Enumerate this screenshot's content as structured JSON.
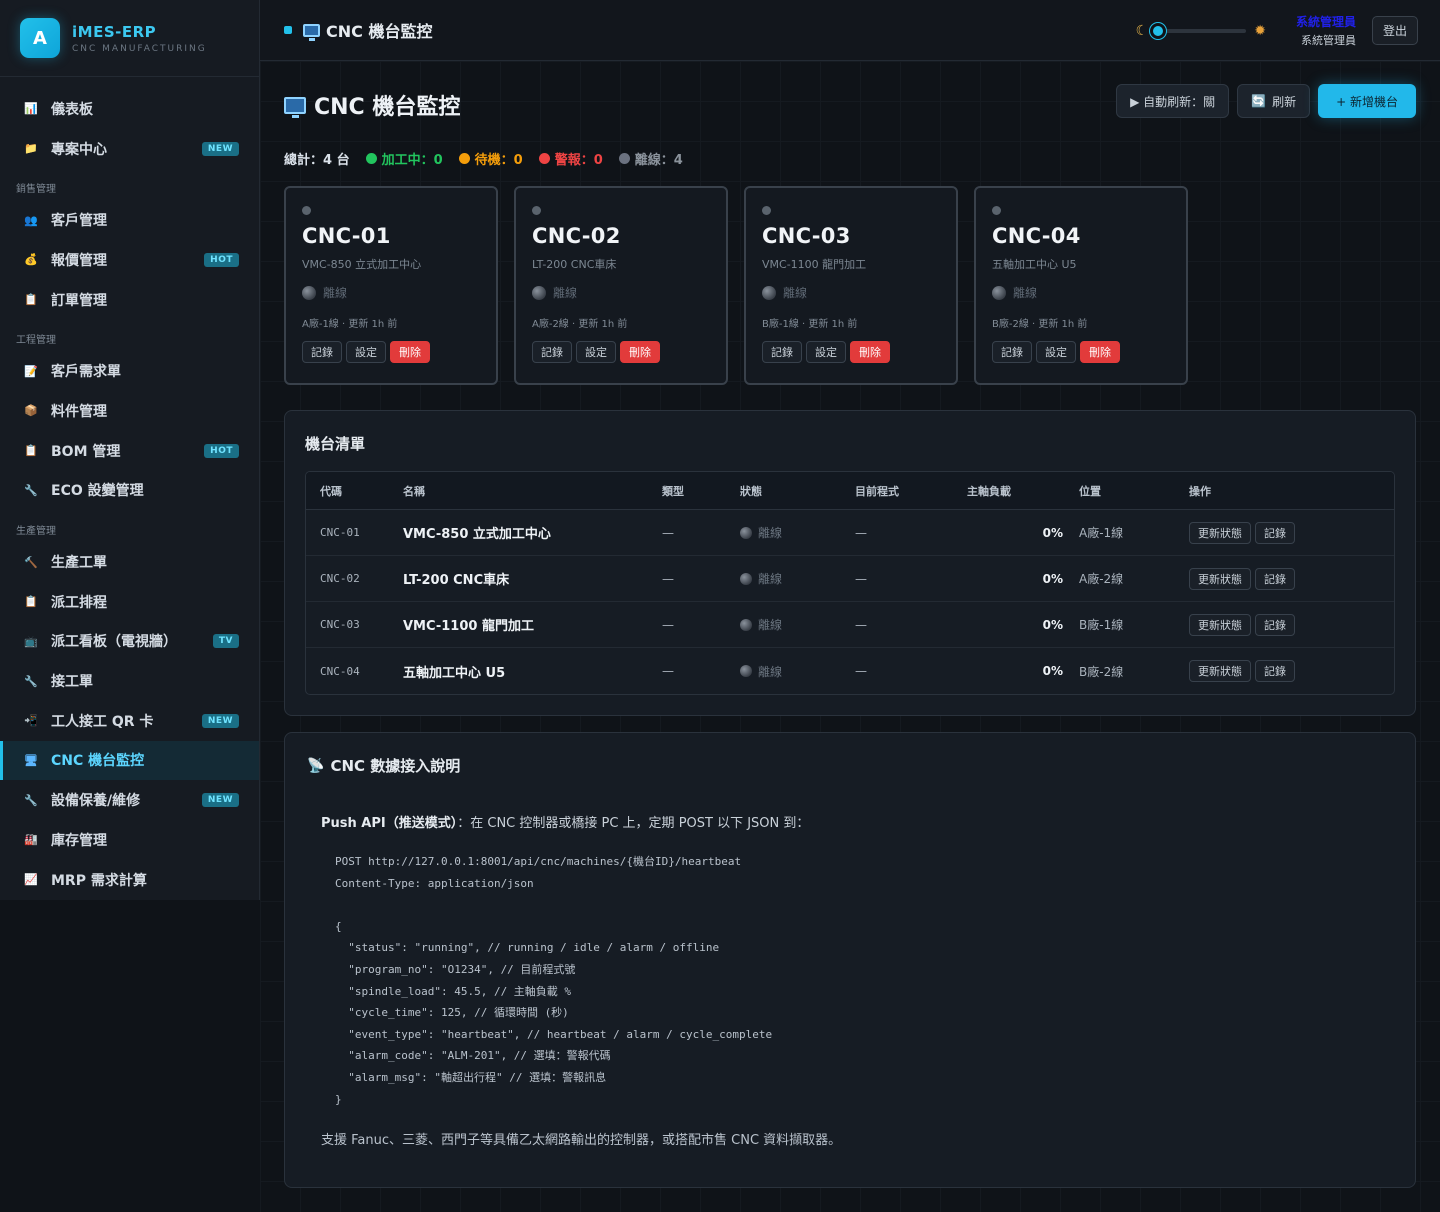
{
  "app": {
    "name": "iMES-ERP",
    "subtitle": "CNC MANUFACTURING",
    "logo_letter": "A"
  },
  "sidebar": {
    "items": [
      {
        "type": "item",
        "label": "儀表板",
        "icon": "chart-icon"
      },
      {
        "type": "item",
        "label": "專案中心",
        "icon": "folder-icon",
        "badge": "NEW"
      },
      {
        "type": "section",
        "label": "銷售管理"
      },
      {
        "type": "item",
        "label": "客戶管理",
        "icon": "users-icon"
      },
      {
        "type": "item",
        "label": "報價管理",
        "icon": "money-bag-icon",
        "badge": "HOT"
      },
      {
        "type": "item",
        "label": "訂單管理",
        "icon": "clipboard-icon"
      },
      {
        "type": "section",
        "label": "工程管理"
      },
      {
        "type": "item",
        "label": "客戶需求單",
        "icon": "document-icon"
      },
      {
        "type": "item",
        "label": "料件管理",
        "icon": "package-icon"
      },
      {
        "type": "item",
        "label": "BOM 管理",
        "icon": "clipboard-icon",
        "badge": "HOT"
      },
      {
        "type": "item",
        "label": "ECO 設變管理",
        "icon": "wrench-icon"
      },
      {
        "type": "section",
        "label": "生產管理"
      },
      {
        "type": "item",
        "label": "生產工單",
        "icon": "hammer-icon"
      },
      {
        "type": "item",
        "label": "派工排程",
        "icon": "clipboard-icon"
      },
      {
        "type": "item",
        "label": "派工看板（電視牆）",
        "icon": "tv-icon",
        "badge": "TV"
      },
      {
        "type": "item",
        "label": "接工單",
        "icon": "wrench-icon"
      },
      {
        "type": "item",
        "label": "工人接工 QR 卡",
        "icon": "qr-icon",
        "badge": "NEW"
      },
      {
        "type": "item",
        "label": "CNC 機台監控",
        "icon": "monitor-icon",
        "active": true
      },
      {
        "type": "item",
        "label": "設備保養/維修",
        "icon": "wrench-icon",
        "badge": "NEW"
      },
      {
        "type": "item",
        "label": "庫存管理",
        "icon": "factory-icon"
      },
      {
        "type": "item",
        "label": "MRP 需求計算",
        "icon": "line-chart-icon"
      }
    ]
  },
  "topbar": {
    "title": "CNC 機台監控",
    "user_name": "系統管理員",
    "user_role": "系統管理員",
    "logout": "登出",
    "theme_moon_icon": "moon-icon",
    "theme_sun_icon": "sun-icon"
  },
  "page": {
    "title": "CNC 機台監控",
    "auto_refresh": "▶ 自動刷新：關",
    "refresh": "刷新",
    "add_machine": "+ 新增機台"
  },
  "stats": {
    "total_label": "總計：",
    "total_value": "4 台",
    "running": "加工中：0",
    "idle": "待機：0",
    "alarm": "警報：0",
    "offline": "離線：4",
    "colors": {
      "running": "#22c55e",
      "idle": "#f59e0b",
      "alarm": "#ef4444",
      "offline": "#6b7280"
    }
  },
  "machines": [
    {
      "code": "CNC-01",
      "model": "VMC-850 立式加工中心",
      "status": "離線",
      "meta": "A廠-1線 · 更新 1h 前",
      "type": "—",
      "program": "—",
      "load": "0%",
      "location": "A廠-1線"
    },
    {
      "code": "CNC-02",
      "model": "LT-200 CNC車床",
      "status": "離線",
      "meta": "A廠-2線 · 更新 1h 前",
      "type": "—",
      "program": "—",
      "load": "0%",
      "location": "A廠-2線"
    },
    {
      "code": "CNC-03",
      "model": "VMC-1100 龍門加工",
      "status": "離線",
      "meta": "B廠-1線 · 更新 1h 前",
      "type": "—",
      "program": "—",
      "load": "0%",
      "location": "B廠-1線"
    },
    {
      "code": "CNC-04",
      "model": "五軸加工中心 U5",
      "status": "離線",
      "meta": "B廠-2線 · 更新 1h 前",
      "type": "—",
      "program": "—",
      "load": "0%",
      "location": "B廠-2線"
    }
  ],
  "card_actions": {
    "log": "記錄",
    "settings": "設定",
    "delete": "刪除"
  },
  "list": {
    "title": "機台清單",
    "columns": [
      "代碼",
      "名稱",
      "類型",
      "狀態",
      "目前程式",
      "主軸負載",
      "位置",
      "操作"
    ],
    "update_status": "更新狀態",
    "log": "記錄"
  },
  "guide": {
    "title": "CNC 數據接入說明",
    "intro_bold": "Push API（推送模式）",
    "intro_rest": "：在 CNC 控制器或橋接 PC 上，定期 POST 以下 JSON 到：",
    "code": "POST http://127.0.0.1:8001/api/cnc/machines/{機台ID}/heartbeat\nContent-Type: application/json\n\n{\n  \"status\": \"running\", // running / idle / alarm / offline\n  \"program_no\": \"O1234\", // 目前程式號\n  \"spindle_load\": 45.5, // 主軸負載 %\n  \"cycle_time\": 125, // 循環時間 (秒)\n  \"event_type\": \"heartbeat\", // heartbeat / alarm / cycle_complete\n  \"alarm_code\": \"ALM-201\", // 選填：警報代碼\n  \"alarm_msg\": \"軸超出行程\" // 選填：警報訊息\n}",
    "footer": "支援 Fanuc、三菱、西門子等具備乙太網路輸出的控制器，或搭配市售 CNC 資料擷取器。"
  }
}
